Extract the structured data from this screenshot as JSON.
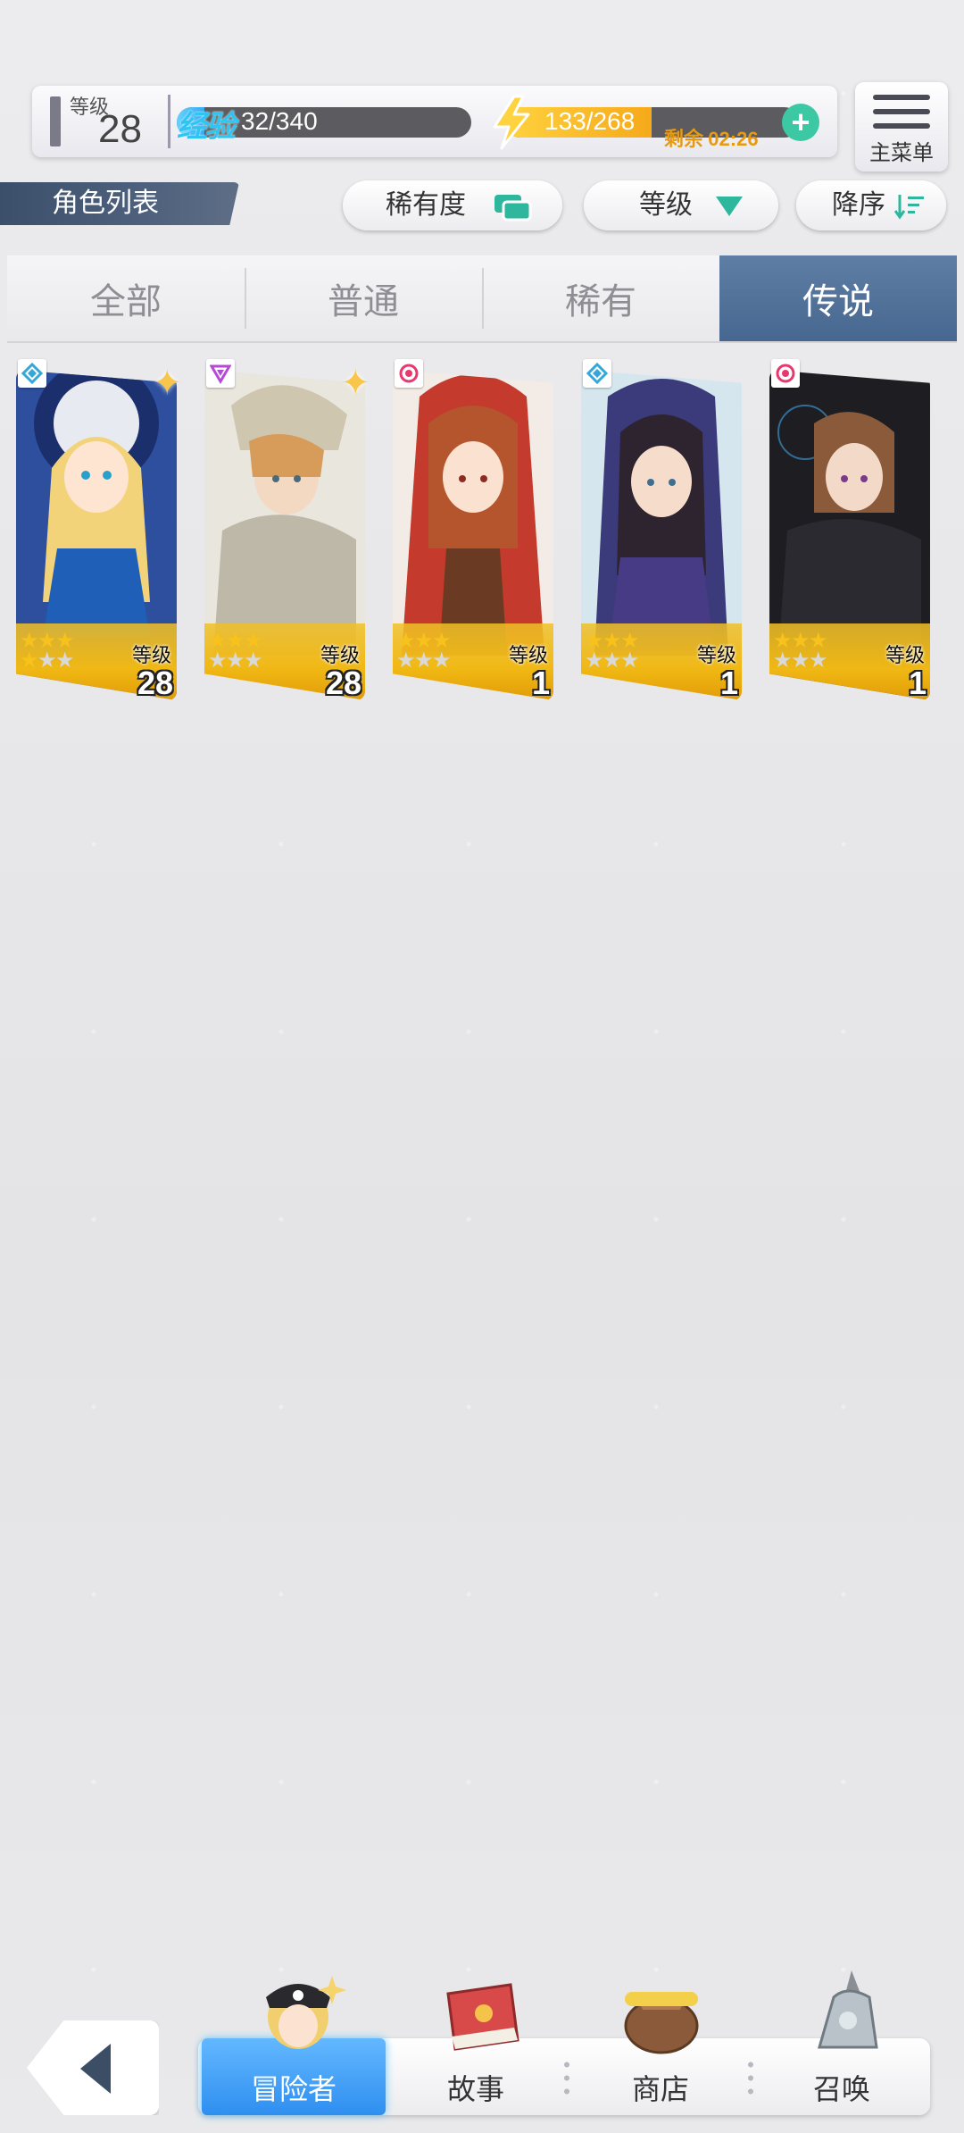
{
  "status": {
    "level_label": "等级",
    "level_value": "28",
    "exp_tag": "经验",
    "exp_text": "32/340",
    "exp_progress": 0.094,
    "stamina_text": "133/268",
    "stamina_progress": 0.496,
    "timer_prefix": "剩余",
    "timer_value": "02:26"
  },
  "main_menu": {
    "label": "主菜单"
  },
  "title": "角色列表",
  "sort": {
    "rarity_label": "稀有度",
    "level_label": "等级",
    "order_label": "降序"
  },
  "tabs": [
    {
      "label": "全部",
      "active": false
    },
    {
      "label": "普通",
      "active": false
    },
    {
      "label": "稀有",
      "active": false
    },
    {
      "label": "传说",
      "active": true
    }
  ],
  "characters": [
    {
      "level_label": "等级",
      "level": "28",
      "stars": 3,
      "attribute": "water-icon",
      "sparkle": true
    },
    {
      "level_label": "等级",
      "level": "28",
      "stars": 3,
      "attribute": "triangle-icon",
      "sparkle": true
    },
    {
      "level_label": "等级",
      "level": "1",
      "stars": 3,
      "attribute": "flame-icon",
      "sparkle": false
    },
    {
      "level_label": "等级",
      "level": "1",
      "stars": 3,
      "attribute": "water-icon",
      "sparkle": false
    },
    {
      "level_label": "等级",
      "level": "1",
      "stars": 3,
      "attribute": "flame-icon",
      "sparkle": false
    }
  ],
  "nav": {
    "items": [
      {
        "label": "冒险者",
        "active": true
      },
      {
        "label": "故事",
        "active": false
      },
      {
        "label": "商店",
        "active": false
      },
      {
        "label": "召唤",
        "active": false
      }
    ]
  },
  "colors": {
    "tab_active": "#4e6f98",
    "exp_fill": "#3aa9ee",
    "stamina_fill": "#f5a91a",
    "card_foot": "#f0b814",
    "plus_button": "#3cc8a2"
  }
}
